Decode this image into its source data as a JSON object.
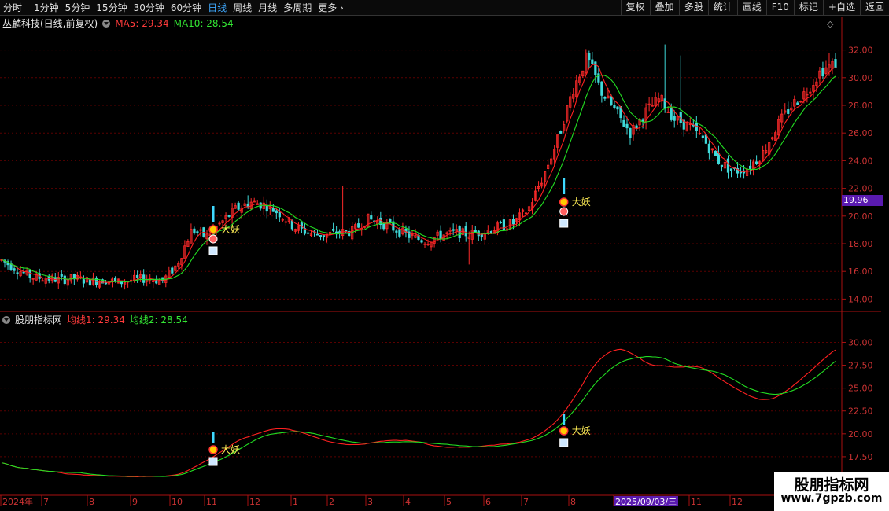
{
  "toolbar": {
    "periods": [
      "分时",
      "1分钟",
      "5分钟",
      "15分钟",
      "30分钟",
      "60分钟",
      "日线",
      "周线",
      "月线",
      "多周期",
      "更多"
    ],
    "active_period": "日线",
    "right_buttons": [
      "复权",
      "叠加",
      "多股",
      "统计",
      "画线",
      "F10",
      "标记",
      "+自选",
      "返回"
    ]
  },
  "main_chart": {
    "title": "丛麟科技(日线,前复权)",
    "ma5_label": "MA5: 29.34",
    "ma10_label": "MA10: 28.54",
    "price_ticks": [
      "32.00",
      "30.00",
      "28.00",
      "26.00",
      "24.00",
      "22.00",
      "20.00",
      "18.00",
      "16.00",
      "14.00"
    ],
    "price_tag": "19.96",
    "signal_label": "大妖"
  },
  "indicator": {
    "title": "股朋指标网",
    "line1_label": "均线1: 29.34",
    "line2_label": "均线2: 28.54",
    "ticks": [
      "30.00",
      "27.50",
      "25.00",
      "22.50",
      "20.00",
      "17.50"
    ],
    "signal_label": "大妖"
  },
  "timeline": {
    "labels": [
      "2024年",
      "7",
      "8",
      "9",
      "10",
      "11",
      "12",
      "1",
      "2",
      "3",
      "4",
      "5",
      "6",
      "7",
      "8",
      "2025/09/03/三",
      "11",
      "12"
    ]
  },
  "watermark": {
    "line1": "股朋指标网",
    "line2": "www.7gpzb.com"
  },
  "colors": {
    "up": "#ff2a2a",
    "down": "#3fd9d9",
    "ma5": "#ff2020",
    "ma10": "#22dd22",
    "grid": "#5a0000",
    "axis": "#aa1111"
  },
  "chart_data": {
    "type": "candlestick",
    "title": "丛麟科技(日线,前复权)",
    "x": [
      "2024年",
      "7",
      "8",
      "9",
      "10",
      "11",
      "12",
      "1",
      "2",
      "3",
      "4",
      "5",
      "6",
      "7",
      "8",
      "9",
      "10",
      "11",
      "12"
    ],
    "y_range": [
      13,
      33
    ],
    "closes": [
      16.8,
      16.2,
      15.6,
      15.5,
      15.4,
      15.5,
      15.3,
      15.4,
      15.2,
      15.4,
      15.5,
      15.3,
      16.5,
      19.0,
      18.5,
      19.5,
      20.5,
      21.0,
      20.8,
      20.2,
      19.2,
      18.8,
      18.6,
      18.8,
      18.9,
      19.8,
      19.5,
      19.0,
      18.5,
      18.2,
      18.6,
      18.8,
      18.7,
      18.9,
      19.2,
      19.5,
      20.5,
      22.8,
      25.5,
      29.0,
      31.5,
      29.0,
      27.5,
      26.0,
      27.5,
      28.5,
      27.0,
      26.5,
      25.5,
      24.0,
      23.2,
      23.5,
      24.5,
      26.5,
      28.0,
      29.0,
      30.5,
      31.0
    ],
    "ma5_end": 29.34,
    "ma10_end": 28.54,
    "signals": [
      "大妖",
      "大妖"
    ]
  }
}
